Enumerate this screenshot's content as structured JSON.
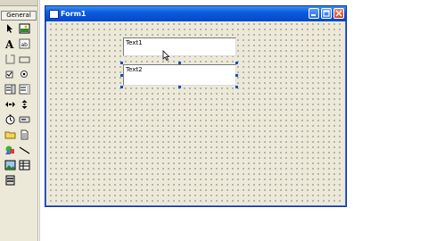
{
  "toolbox": {
    "tab_label": "General",
    "tools": [
      {
        "name": "pointer-icon"
      },
      {
        "name": "picturebox-icon"
      },
      {
        "name": "label-icon"
      },
      {
        "name": "textbox-icon"
      },
      {
        "name": "frame-icon"
      },
      {
        "name": "commandbutton-icon"
      },
      {
        "name": "checkbox-icon"
      },
      {
        "name": "optionbutton-icon"
      },
      {
        "name": "combobox-icon"
      },
      {
        "name": "listbox-icon"
      },
      {
        "name": "hscrollbar-icon"
      },
      {
        "name": "vscrollbar-icon"
      },
      {
        "name": "timer-icon"
      },
      {
        "name": "drivelistbox-icon"
      },
      {
        "name": "dirlistbox-icon"
      },
      {
        "name": "filelistbox-icon"
      },
      {
        "name": "shape-icon"
      },
      {
        "name": "line-icon"
      },
      {
        "name": "image-icon"
      },
      {
        "name": "data-icon"
      },
      {
        "name": "ole-icon"
      }
    ]
  },
  "form": {
    "title": "Form1",
    "textbox1": "Text1",
    "textbox2": "Text2"
  },
  "colors": {
    "titlebar": "#0a5ce0",
    "canvas": "#ece9d8",
    "close_button": "#d24321"
  }
}
